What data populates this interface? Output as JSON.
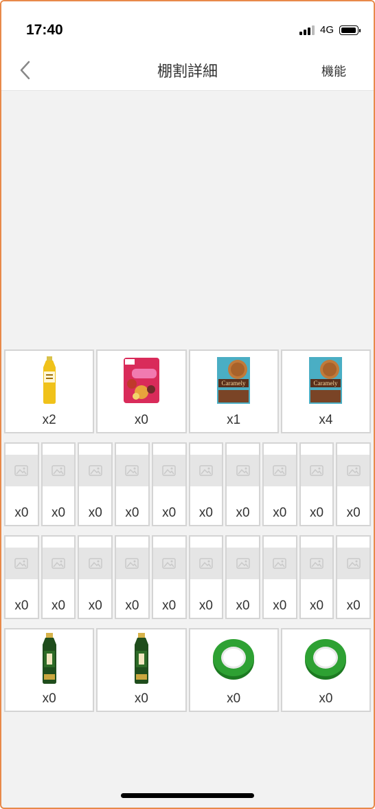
{
  "status_bar": {
    "time": "17:40",
    "network": "4G"
  },
  "nav": {
    "title": "棚割詳細",
    "function_label": "機能"
  },
  "shelves": {
    "row1": [
      {
        "product": "yellow-tea-bottle",
        "count": "x2"
      },
      {
        "product": "granola-bag",
        "count": "x0"
      },
      {
        "product": "caramely-cookie-box",
        "count": "x1"
      },
      {
        "product": "caramely-cookie-box",
        "count": "x4"
      }
    ],
    "row2": [
      "x0",
      "x0",
      "x0",
      "x0",
      "x0",
      "x0",
      "x0",
      "x0",
      "x0",
      "x0"
    ],
    "row3": [
      "x0",
      "x0",
      "x0",
      "x0",
      "x0",
      "x0",
      "x0",
      "x0",
      "x0",
      "x0"
    ],
    "row4": [
      {
        "product": "green-tea-bottle",
        "count": "x0"
      },
      {
        "product": "green-tea-bottle",
        "count": "x0"
      },
      {
        "product": "green-tape-roll",
        "count": "x0"
      },
      {
        "product": "green-tape-roll",
        "count": "x0"
      }
    ]
  },
  "colors": {
    "frame_border": "#e8894a",
    "background": "#f2f2f2",
    "cell_border": "#d4d4d4"
  }
}
